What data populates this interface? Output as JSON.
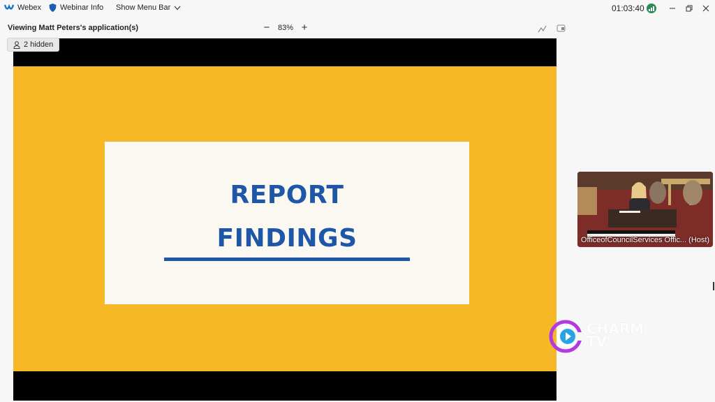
{
  "titlebar": {
    "app_name": "Webex",
    "webinar_info": "Webinar Info",
    "show_menu_bar": "Show Menu Bar",
    "clock": "01:03:40"
  },
  "share": {
    "title": "Viewing Matt Peters's application(s)",
    "zoom_level": "83%",
    "hidden_count_label": "2 hidden"
  },
  "slide": {
    "line1": "REPORT",
    "line2": "FINDINGS"
  },
  "video": {
    "participant_name": "OfficeofCouncilServices Offic... (Host)"
  },
  "watermark": {
    "text_line1": "CHARM",
    "text_line2": "TV"
  },
  "colors": {
    "slide_background": "#f6b825",
    "slide_text": "#1e56a8",
    "card": "#fbf8f2",
    "signal_badge": "#2e8b57"
  }
}
